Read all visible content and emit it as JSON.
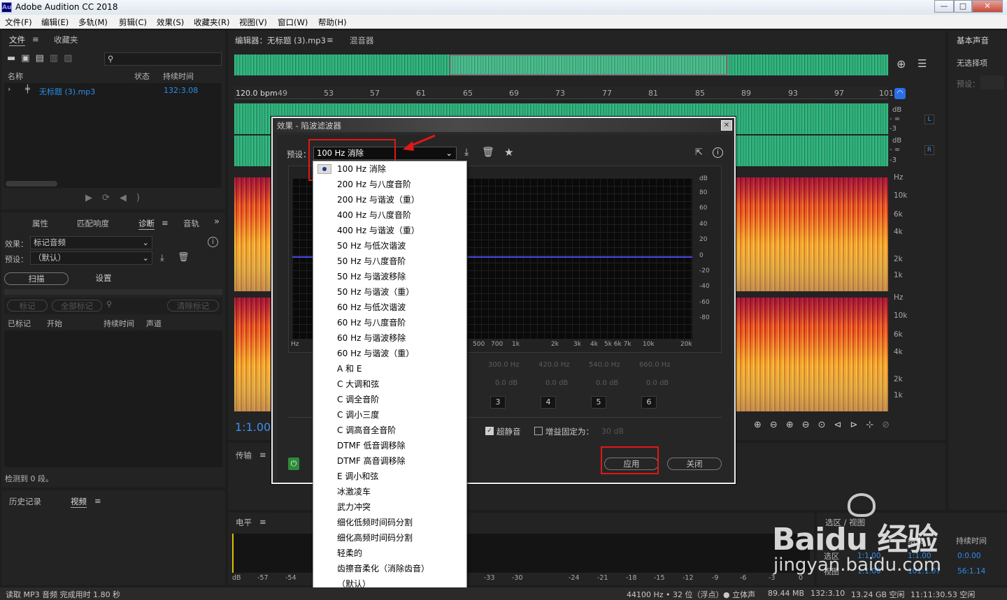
{
  "window": {
    "title": "Adobe Audition CC 2018",
    "logo": "Au",
    "controls": [
      "—",
      "□",
      "✕"
    ]
  },
  "menu": [
    "文件(F)",
    "编辑(E)",
    "多轨(M)",
    "剪辑(C)",
    "效果(S)",
    "收藏夹(R)",
    "视图(V)",
    "窗口(W)",
    "帮助(H)"
  ],
  "files_panel": {
    "tabs": [
      "文件",
      "收藏夹"
    ],
    "columns": [
      "名称",
      "状态",
      "持续时间"
    ],
    "file": {
      "name": "无标题 (3).mp3",
      "duration": "132:3.08"
    }
  },
  "diag_panel": {
    "tabs": [
      "属性",
      "匹配响度",
      "诊断",
      "音轨"
    ],
    "effect_label": "效果：",
    "effect_value": "标记音频",
    "preset_label": "预设：",
    "preset_value": "（默认）",
    "scan_btn": "扫描",
    "settings_btn": "设置",
    "mark_btn": "标记",
    "mark_all_btn": "全部标记",
    "clear_btn": "清除标记",
    "columns": [
      "已标记",
      "开始",
      "持续时间",
      "声道"
    ],
    "status": "检测到 0 段。"
  },
  "history_panel": {
    "tabs": [
      "历史记录",
      "视频"
    ]
  },
  "editor": {
    "tab_title": "编辑器：无标题 (3).mp3",
    "mixer_tab": "混音器",
    "bpm": "120.0 bpm",
    "ruler": [
      "49",
      "53",
      "57",
      "61",
      "65",
      "69",
      "73",
      "77",
      "81",
      "85",
      "89",
      "93",
      "97",
      "101"
    ],
    "db_labels": [
      "dB",
      "- ∞",
      "-3",
      "dB",
      "- ∞",
      "-3"
    ],
    "ch_labels": [
      "L",
      "R"
    ],
    "hz_labels": [
      "Hz",
      "10k",
      "6k",
      "4k",
      "2k",
      "1k",
      "Hz",
      "10k",
      "6k",
      "4k",
      "2k",
      "1k"
    ],
    "timecode": "1:1.00"
  },
  "transport": {
    "label": "传输"
  },
  "levels": {
    "label": "电平",
    "scale": [
      "dB",
      "-57",
      "-54",
      "-33",
      "-30",
      "-24",
      "-21",
      "-18",
      "-15",
      "-12",
      "-9",
      "-6",
      "-3",
      "0"
    ]
  },
  "right_panel": {
    "title": "基本声音",
    "no_selection": "无选择项",
    "preset_label": "预设："
  },
  "selection_panel": {
    "title": "选区 / 视图",
    "col_end": "结束",
    "col_duration": "持续时间",
    "sel_label": "选区",
    "view_label": "视图",
    "sel_start": "1:1.00",
    "sel_end": "1:1.00",
    "sel_dur": "0:0.00",
    "view_start": "1:1.00",
    "view_end": "101:1.07",
    "view_dur": "56:1.14"
  },
  "dialog": {
    "title": "效果 - 陷波滤波器",
    "preset_label": "预设：",
    "preset_value": "100 Hz 消除",
    "db_axis": [
      "dB",
      "80",
      "60",
      "40",
      "20",
      "0",
      "-20",
      "-40",
      "-60",
      "-80"
    ],
    "hz_axis": [
      "Hz",
      "500",
      "700",
      "1k",
      "2k",
      "3k",
      "4k",
      "5k 6k 7k",
      "10k",
      "20k"
    ],
    "bands_freq": [
      "300.0 Hz",
      "420.0 Hz",
      "540.0 Hz",
      "660.0 Hz"
    ],
    "bands_gain": [
      "0.0 dB",
      "0.0 dB",
      "0.0 dB",
      "0.0 dB"
    ],
    "bands_num": [
      "3",
      "4",
      "5",
      "6"
    ],
    "ultra_quiet": "超静音",
    "fixed_gain_label": "增益固定为：",
    "fixed_gain_value": "30 dB",
    "apply": "应用",
    "close": "关闭"
  },
  "preset_menu": [
    "100 Hz 消除",
    "200 Hz 与八度音阶",
    "200 Hz 与谐波（重）",
    "400 Hz 与八度音阶",
    "400 Hz 与谐波（重）",
    "50 Hz 与低次谐波",
    "50 Hz 与八度音阶",
    "50 Hz 与谐波移除",
    "50 Hz 与谐波（重）",
    "60 Hz 与低次谐波",
    "60 Hz 与八度音阶",
    "60 Hz 与谐波移除",
    "60 Hz 与谐波（重）",
    "A 和 E",
    "C 大调和弦",
    "C 调全音阶",
    "C 调小三度",
    "C 调高音全音阶",
    "DTMF 低音调移除",
    "DTMF 高音调移除",
    "E 调小和弦",
    "冰激凌车",
    "武力冲突",
    "细化低频时间码分割",
    "细化高频时间码分割",
    "轻柔的",
    "齿擦音柔化（消除齿音）",
    "（默认）"
  ],
  "status_bar": {
    "left": "读取 MP3 音频 完成用时 1.80 秒",
    "items": [
      "44100 Hz • 32 位（浮点）",
      "● 立体声",
      "89.44 MB",
      "132:3.10",
      "13.24 GB 空闲",
      "11:11:30.53 空闲"
    ]
  },
  "watermark": {
    "brand": "Baidu 经验",
    "url": "jingyan.baidu.com"
  },
  "colors": {
    "accent": "#2c8ee8",
    "waveform": "#37c68c",
    "highlight": "#e01818",
    "graph_line": "#4a4ae8"
  }
}
